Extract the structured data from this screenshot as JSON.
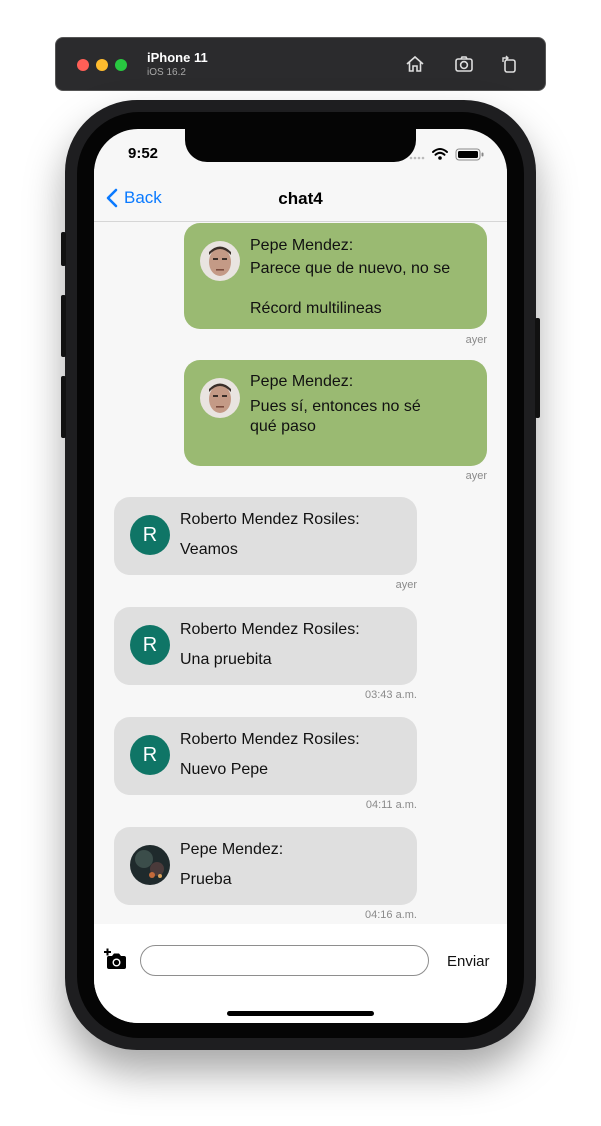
{
  "simulator": {
    "device": "iPhone 11",
    "os": "iOS 16.2",
    "icons": [
      "home-icon",
      "screenshot-icon",
      "rotate-icon"
    ]
  },
  "status_bar": {
    "time": "9:52"
  },
  "nav": {
    "back_label": "Back",
    "title": "chat4"
  },
  "messages": [
    {
      "direction": "out",
      "author": "Pepe Mendez:",
      "lines": [
        "Parece que de nuevo, no se",
        "",
        "Récord multilineas"
      ],
      "time": "ayer",
      "avatar": "photo"
    },
    {
      "direction": "out",
      "author": "Pepe Mendez:",
      "lines": [
        "Pues sí, entonces no sé",
        "qué paso"
      ],
      "time": "ayer",
      "avatar": "photo"
    },
    {
      "direction": "in",
      "author": "Roberto Mendez Rosiles:",
      "lines": [
        "Veamos"
      ],
      "time": "ayer",
      "avatar": "R"
    },
    {
      "direction": "in",
      "author": "Roberto Mendez Rosiles:",
      "lines": [
        "Una pruebita"
      ],
      "time": "03:43 a.m.",
      "avatar": "R"
    },
    {
      "direction": "in",
      "author": "Roberto Mendez Rosiles:",
      "lines": [
        "Nuevo Pepe"
      ],
      "time": "04:11 a.m.",
      "avatar": "R"
    },
    {
      "direction": "in",
      "author": "Pepe Mendez:",
      "lines": [
        "Prueba"
      ],
      "time": "04:16 a.m.",
      "avatar": "photo-dark"
    }
  ],
  "composer": {
    "placeholder": "",
    "value": "",
    "send_label": "Enviar",
    "camera_icon": "add-photo-icon"
  },
  "colors": {
    "outgoing_bubble": "#9aba72",
    "incoming_bubble": "#dfdfdf",
    "avatar_bg": "#0f7566",
    "link": "#0a7aff"
  }
}
